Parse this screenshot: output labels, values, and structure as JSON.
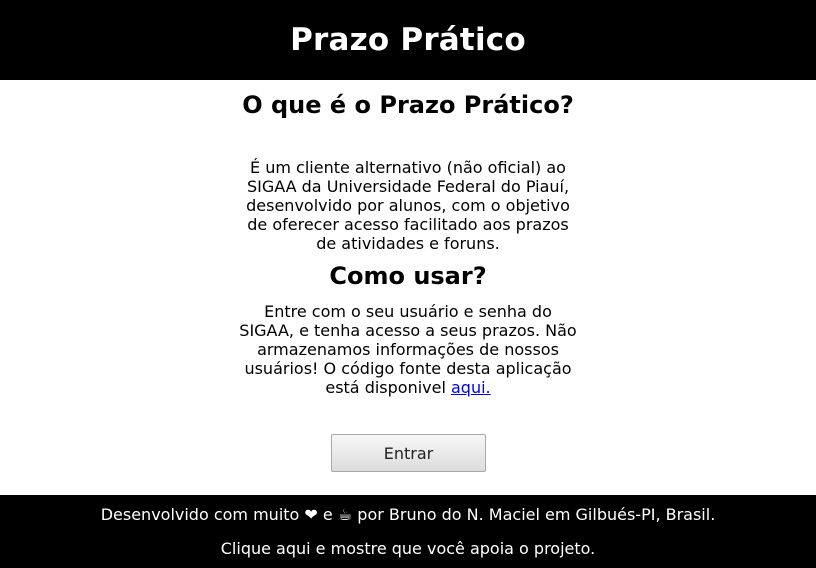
{
  "header": {
    "title": "Prazo Prático"
  },
  "about": {
    "heading": "O que é o Prazo Prático?",
    "text": "É um cliente alternativo (não oficial) ao SIGAA da Universidade Federal do Piauí, desenvolvido por alunos, com o objetivo de oferecer acesso facilitado aos prazos de atividades e foruns."
  },
  "how_to": {
    "heading": "Como usar?",
    "text": "Entre com o seu usuário e senha do SIGAA, e tenha acesso a seus prazos. Não armazenamos informações de nossos usuários! O código fonte desta aplicação está disponivel ",
    "link_label": "aqui."
  },
  "login": {
    "button_label": "Entrar"
  },
  "footer": {
    "credit_prefix": "Desenvolvido com muito",
    "heart": "❤",
    "and": "e",
    "coffee": "☕",
    "credit_suffix": "por Bruno do N. Maciel em Gilbués-PI, Brasil.",
    "support_link": "Clique aqui e mostre que você apoia o projeto."
  }
}
